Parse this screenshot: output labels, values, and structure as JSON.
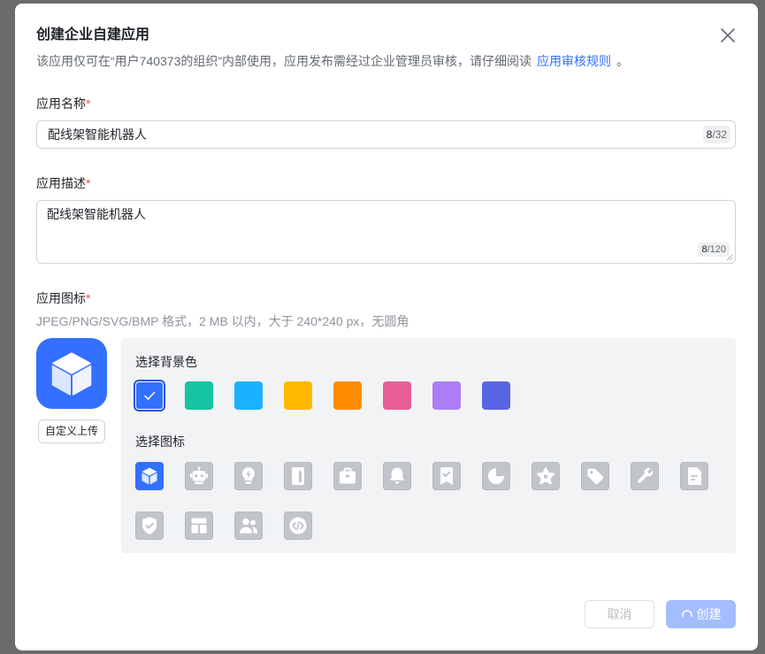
{
  "dialog": {
    "title": "创建企业自建应用",
    "close_icon": "close-icon",
    "description": "该应用仅可在“用户740373的组织”内部使用，应用发布需经过企业管理员审核，请仔细阅读",
    "rules_link": "应用审核规则",
    "description_end": "。"
  },
  "form": {
    "name": {
      "label": "应用名称",
      "required_mark": "*",
      "value": "配线架智能机器人",
      "count": "8",
      "limit": "/32"
    },
    "description": {
      "label": "应用描述",
      "required_mark": "*",
      "value": "配线架智能机器人",
      "count": "8",
      "limit": "/120"
    },
    "icon": {
      "label": "应用图标",
      "required_mark": "*",
      "hint": "JPEG/PNG/SVG/BMP 格式，2 MB 以内，大于 240*240 px，无圆角",
      "preview_icon": "cube-icon",
      "upload_label": "自定义上传",
      "background_heading": "选择背景色",
      "background_colors": [
        "#3370ff",
        "#16c4a2",
        "#1ab2ff",
        "#ffb800",
        "#ff8c00",
        "#e95e97",
        "#ad7df5",
        "#5965e6"
      ],
      "selected_background": 0,
      "icon_heading": "选择图标",
      "icons": [
        "cube-icon",
        "robot-icon",
        "lightbulb-icon",
        "door-icon",
        "briefcase-icon",
        "bell-icon",
        "bookmark-check-icon",
        "pie-chart-icon",
        "star-badge-icon",
        "tag-icon",
        "wrench-icon",
        "document-icon",
        "shield-check-icon",
        "layout-icon",
        "users-icon",
        "code-icon"
      ],
      "selected_icon": 0
    }
  },
  "footer": {
    "cancel_label": "取消",
    "create_label": "创建",
    "create_loading_icon": "spinner-icon"
  },
  "theme": {
    "brand": "#3370ff",
    "required": "#f54a45",
    "overlay": "#6b6b6b",
    "create_disabled": "#a3bdff"
  }
}
